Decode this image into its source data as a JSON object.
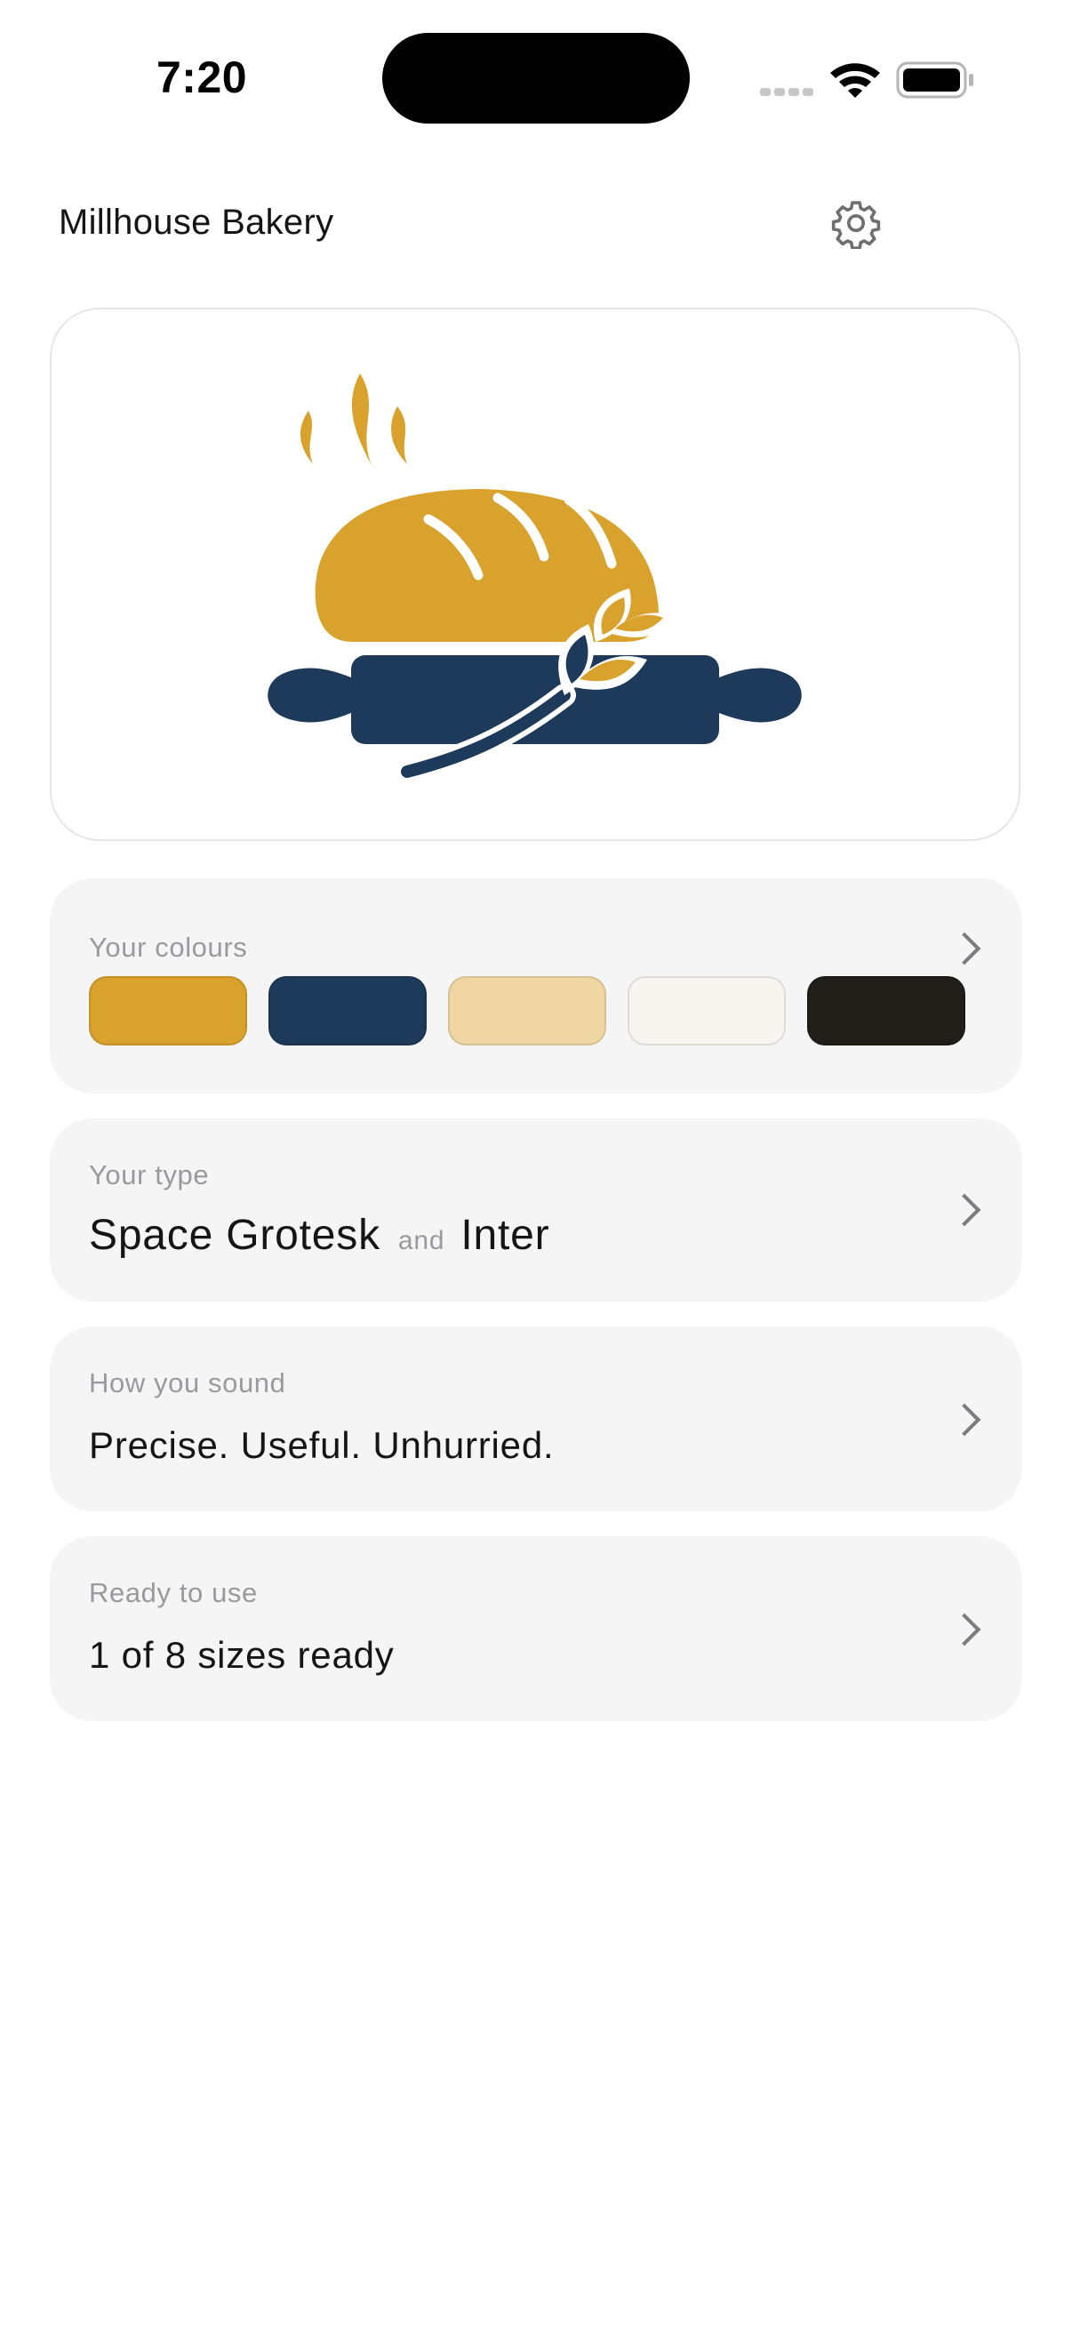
{
  "status_bar": {
    "time": "7:20"
  },
  "header": {
    "title": "Millhouse Bakery",
    "settings_icon": "gear-icon"
  },
  "logo": {
    "icon": "bread-rolling-pin-wheat-logo",
    "colors": {
      "gold": "#d9a22c",
      "navy": "#1e3a5a"
    }
  },
  "colours_card": {
    "label": "Your colours",
    "swatches": [
      "#d9a22c",
      "#1e3a5a",
      "#efd6a2",
      "#f6f5f0",
      "#201e18"
    ]
  },
  "type_card": {
    "label": "Your type",
    "primary_font": "Space Grotesk",
    "joiner": "and",
    "secondary_font": "Inter"
  },
  "voice_card": {
    "label": "How you sound",
    "value": "Precise. Useful. Unhurried."
  },
  "ready_card": {
    "label": "Ready to use",
    "value": "1 of 8 sizes ready"
  }
}
